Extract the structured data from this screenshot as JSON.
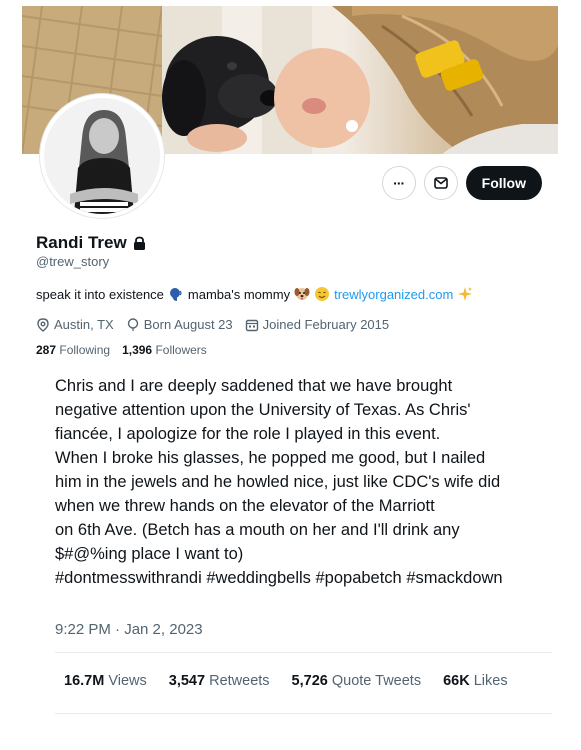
{
  "profile": {
    "name": "Randi Trew",
    "handle": "@trew_story",
    "follow_label": "Follow",
    "more_label": "···",
    "bio_text_1": "speak it into existence",
    "bio_text_2": "mamba's mommy",
    "bio_link": "trewlyorganized.com",
    "location": "Austin, TX",
    "birthday": "Born August 23",
    "joined": "Joined February 2015",
    "following_count": "287",
    "following_label": "Following",
    "followers_count": "1,396",
    "followers_label": "Followers"
  },
  "tweet": {
    "lines": [
      "Chris and I are deeply saddened that we have brought",
      "negative attention upon the University of Texas. As Chris'",
      "fiancée, I apologize for the role I played in this event.",
      "When I broke his glasses, he popped me good, but I nailed",
      "him in the jewels and he howled nice, just like CDC's wife did",
      "when we threw hands on the elevator of the Marriott",
      "on 6th Ave. (Betch has a mouth on her and I'll drink any",
      "$#@%ing place I want to)",
      "#dontmesswithrandi #weddingbells #popabetch #smackdown"
    ],
    "timestamp": "9:22 PM · Jan 2, 2023",
    "views_count": "16.7M",
    "views_label": "Views",
    "retweets_count": "3,547",
    "retweets_label": "Retweets",
    "quotes_count": "5,726",
    "quotes_label": "Quote Tweets",
    "likes_count": "66K",
    "likes_label": "Likes"
  },
  "icons": {
    "lock": "lock-icon",
    "mail": "mail-icon",
    "location": "location-icon",
    "birthday": "balloon-icon",
    "calendar": "calendar-icon"
  },
  "colors": {
    "link": "#1d9bf0",
    "secondary_text": "#536471",
    "follow_bg": "#0f1419"
  }
}
